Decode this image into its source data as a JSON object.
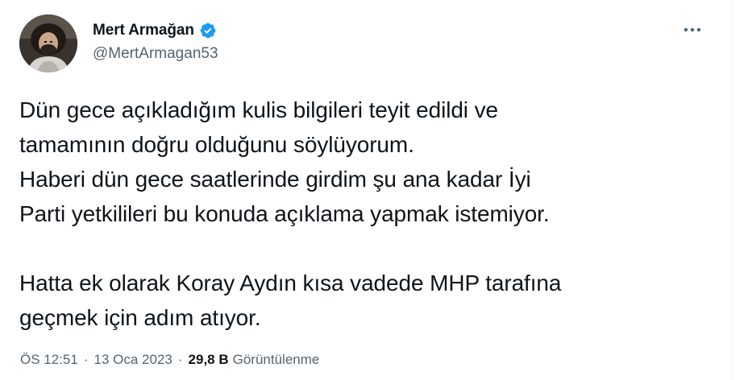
{
  "author": {
    "display_name": "Mert Armağan",
    "handle": "@MertArmagan53",
    "verified": true,
    "avatar_icon": "profile-photo"
  },
  "more_icon": "more-dots-icon",
  "tweet": {
    "lines": [
      "Dün gece açıkladığım kulis bilgileri teyit edildi ve",
      "tamamının doğru olduğunu söylüyorum.",
      "Haberi dün gece saatlerinde girdim şu ana kadar İyi",
      "Parti yetkilileri bu konuda açıklama yapmak istemiyor.",
      "",
      "Hatta ek olarak Koray Aydın kısa vadede MHP tarafına",
      "geçmek için adım atıyor."
    ]
  },
  "meta": {
    "time": "ÖS 12:51",
    "separator": "·",
    "date": "13 Oca 2023",
    "views_count": "29,8 B",
    "views_label": "Görüntülenme"
  },
  "colors": {
    "text": "#0f1419",
    "secondary": "#536471",
    "verified": "#1d9bf0",
    "border": "#eff3f4"
  }
}
